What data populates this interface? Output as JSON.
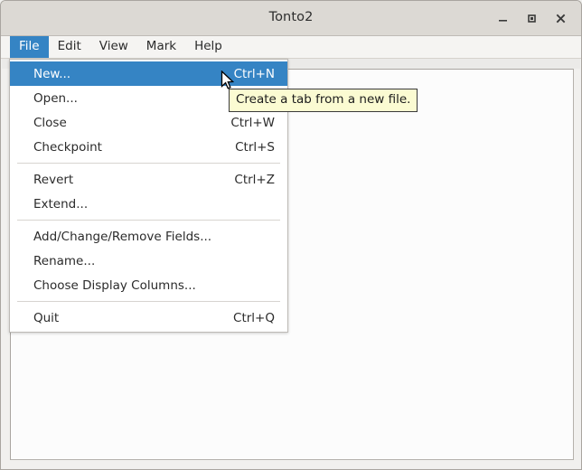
{
  "window": {
    "title": "Tonto2",
    "controls": [
      {
        "name": "minimize",
        "glyph": "_"
      },
      {
        "name": "maximize",
        "glyph": "▫"
      },
      {
        "name": "close",
        "glyph": "✕"
      }
    ]
  },
  "menubar": {
    "items": [
      {
        "label": "File",
        "open": true
      },
      {
        "label": "Edit",
        "open": false
      },
      {
        "label": "View",
        "open": false
      },
      {
        "label": "Mark",
        "open": false
      },
      {
        "label": "Help",
        "open": false
      }
    ]
  },
  "file_menu": {
    "items": [
      {
        "type": "item",
        "label": "New...",
        "accel": "Ctrl+N",
        "highlight": true
      },
      {
        "type": "item",
        "label": "Open...",
        "accel": "",
        "highlight": false
      },
      {
        "type": "item",
        "label": "Close",
        "accel": "Ctrl+W",
        "highlight": false
      },
      {
        "type": "item",
        "label": "Checkpoint",
        "accel": "Ctrl+S",
        "highlight": false
      },
      {
        "type": "separator"
      },
      {
        "type": "item",
        "label": "Revert",
        "accel": "Ctrl+Z",
        "highlight": false
      },
      {
        "type": "item",
        "label": "Extend...",
        "accel": "",
        "highlight": false
      },
      {
        "type": "separator"
      },
      {
        "type": "item",
        "label": "Add/Change/Remove Fields...",
        "accel": "",
        "highlight": false
      },
      {
        "type": "item",
        "label": "Rename...",
        "accel": "",
        "highlight": false
      },
      {
        "type": "item",
        "label": "Choose Display Columns...",
        "accel": "",
        "highlight": false
      },
      {
        "type": "separator"
      },
      {
        "type": "item",
        "label": "Quit",
        "accel": "Ctrl+Q",
        "highlight": false
      }
    ]
  },
  "tooltip": {
    "text": "Create a tab from a new file."
  },
  "colors": {
    "accent": "#3584c4",
    "titlebar": "#dcd9d4",
    "menubar": "#f5f4f2",
    "tooltip_bg": "#fbfbd2",
    "tooltip_border": "#3a3a3a",
    "panel_bg": "#fcfcfc"
  }
}
